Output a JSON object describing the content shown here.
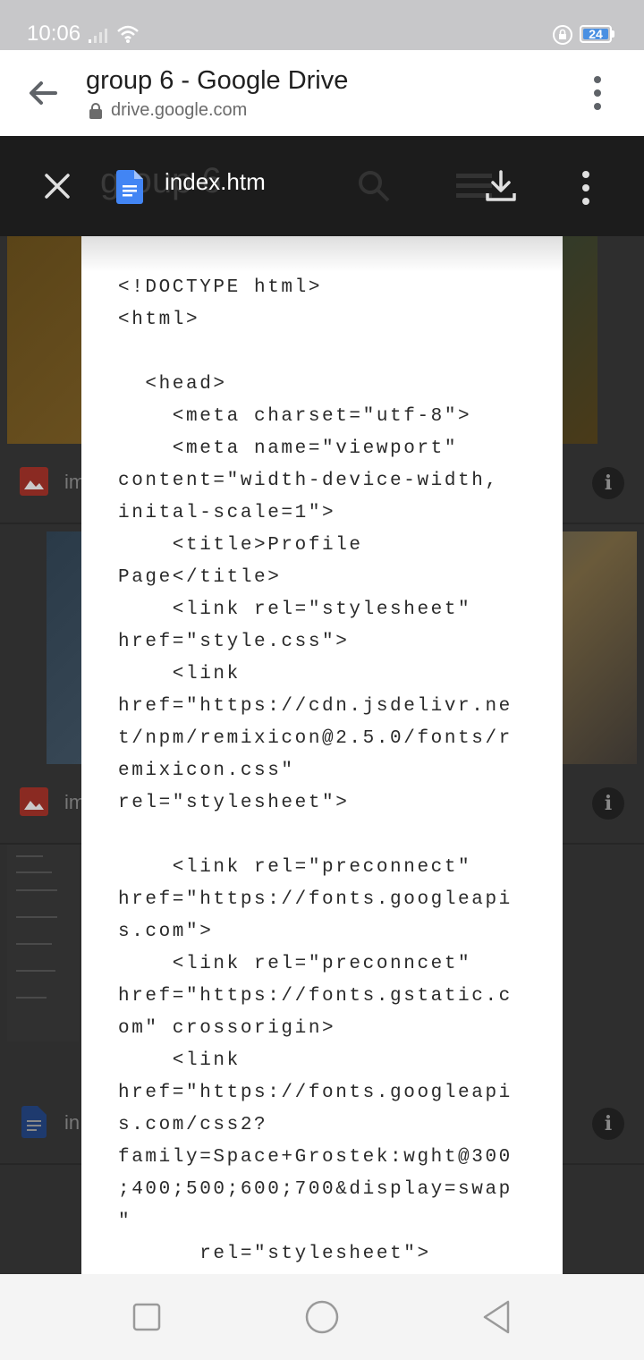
{
  "status_bar": {
    "time": "10:06",
    "battery_level": "24",
    "icons": [
      "signal-icon",
      "wifi-icon",
      "lock-rotation-icon",
      "battery-icon"
    ]
  },
  "browser": {
    "title": "group 6 - Google Drive",
    "url": "drive.google.com",
    "icons": [
      "back-arrow-icon",
      "lock-icon",
      "more-vert-icon"
    ]
  },
  "viewer": {
    "background_title": "group 6",
    "file_name": "index.htm",
    "icons": [
      "close-icon",
      "google-docs-icon",
      "search-icon",
      "list-icon",
      "download-icon",
      "more-vert-icon"
    ]
  },
  "background_files": [
    {
      "name_fragment": "im",
      "type": "image"
    },
    {
      "name_fragment": "im",
      "type": "image"
    },
    {
      "name_fragment": "in",
      "type": "document"
    }
  ],
  "document_lines": [
    "<!DOCTYPE html>",
    "<html>",
    "",
    "  <head>",
    "    <meta charset=\"utf-8\">",
    "    <meta name=\"viewport\"",
    "content=\"width-device-width,",
    "inital-scale=1\">",
    "    <title>Profile",
    "Page</title>",
    "    <link rel=\"stylesheet\"",
    "href=\"style.css\">",
    "    <link",
    "href=\"https://cdn.jsdelivr.ne",
    "t/npm/remixicon@2.5.0/fonts/r",
    "emixicon.css\"",
    "rel=\"stylesheet\">",
    "",
    "    <link rel=\"preconnect\"",
    "href=\"https://fonts.googleapi",
    "s.com\">",
    "    <link rel=\"preconncet\"",
    "href=\"https://fonts.gstatic.c",
    "om\" crossorigin>",
    "    <link",
    "href=\"https://fonts.googleapi",
    "s.com/css2?",
    "family=Space+Grostek:wght@300",
    ";400;500;600;700&display=swap",
    "\"",
    "      rel=\"stylesheet\">"
  ],
  "colors": {
    "status_bar": "#c7c7c9",
    "viewer_bar": "#1c1c1c",
    "doc_icon_blue": "#4285f4",
    "image_icon_red": "#d93025",
    "battery_blue": "#4a90e2"
  },
  "nav": {
    "icons": [
      "recents-square-icon",
      "home-circle-icon",
      "back-triangle-icon"
    ]
  }
}
